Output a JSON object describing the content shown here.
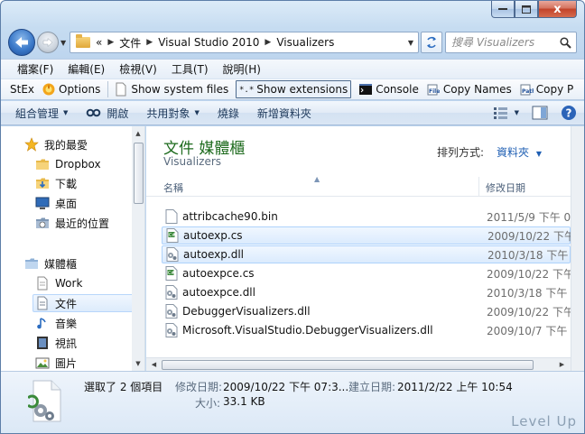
{
  "window": {
    "caption": {
      "minimize": "–",
      "maximize": "□",
      "close": "x"
    }
  },
  "address": {
    "overflow": "«",
    "crumbs": [
      "文件",
      "Visual Studio 2010",
      "Visualizers"
    ],
    "search_placeholder": "搜尋 Visualizers"
  },
  "menu": [
    "檔案(F)",
    "編輯(E)",
    "檢視(V)",
    "工具(T)",
    "說明(H)"
  ],
  "stex": {
    "label": "StEx",
    "options": "Options",
    "show_system_files": "Show system files",
    "show_extensions": "Show extensions",
    "console": "Console",
    "copy_names": "Copy Names",
    "copy_path": "Copy P"
  },
  "commands": {
    "organize": "組合管理",
    "open": "開啟",
    "share": "共用對象",
    "burn": "燒錄",
    "new_folder": "新增資料夾"
  },
  "nav": {
    "favorites": "我的最愛",
    "dropbox": "Dropbox",
    "downloads": "下載",
    "desktop": "桌面",
    "recent": "最近的位置",
    "libraries": "媒體櫃",
    "work": "Work",
    "documents": "文件",
    "music": "音樂",
    "videos": "視訊",
    "pictures": "圖片"
  },
  "content": {
    "title": "文件 媒體櫃",
    "subtitle": "Visualizers",
    "arrange_label": "排列方式:",
    "arrange_value": "資料夾",
    "col_name": "名稱",
    "col_date": "修改日期",
    "files": [
      {
        "name": "attribcache90.bin",
        "date": "2011/5/9 下午 01",
        "icon": "blank-file-icon",
        "selected": false
      },
      {
        "name": "autoexp.cs",
        "date": "2009/10/22 下午 0",
        "icon": "cs-file-icon",
        "selected": true
      },
      {
        "name": "autoexp.dll",
        "date": "2010/3/18 下午 1",
        "icon": "dll-file-icon",
        "selected": true
      },
      {
        "name": "autoexpce.cs",
        "date": "2009/10/22 下午 0",
        "icon": "cs-file-icon",
        "selected": false
      },
      {
        "name": "autoexpce.dll",
        "date": "2010/3/18 下午 1",
        "icon": "dll-file-icon",
        "selected": false
      },
      {
        "name": "DebuggerVisualizers.dll",
        "date": "2009/10/22 下午 07",
        "icon": "dll-file-icon",
        "selected": false
      },
      {
        "name": "Microsoft.VisualStudio.DebuggerVisualizers.dll",
        "date": "2009/10/7 下午 0",
        "icon": "dll-file-icon",
        "selected": false
      }
    ]
  },
  "details": {
    "selected_count": "選取了 2 個項目",
    "modified_label": "修改日期:",
    "modified_value": "2009/10/22 下午 07:3...",
    "created_label": "建立日期:",
    "created_value": "2011/2/22 上午 10:54",
    "size_label": "大小:",
    "size_value": "33.1 KB",
    "watermark": "Level Up"
  }
}
